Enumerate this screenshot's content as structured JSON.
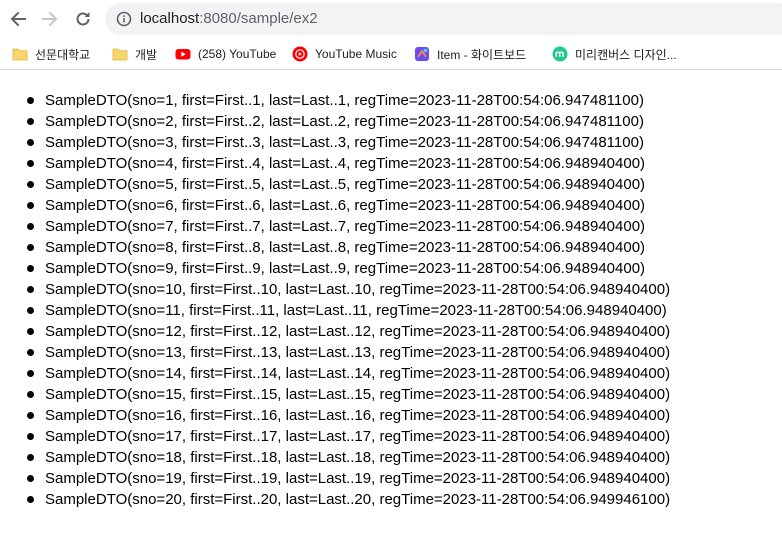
{
  "browser": {
    "url_host": "localhost",
    "url_path": ":8080/sample/ex2"
  },
  "bookmarks": [
    {
      "label": "선문대학교",
      "icon": "folder-icon"
    },
    {
      "label": "개발",
      "icon": "folder-icon"
    },
    {
      "label": "(258) YouTube",
      "icon": "youtube-icon"
    },
    {
      "label": "YouTube Music",
      "icon": "youtube-music-icon"
    },
    {
      "label": "Item - 화이트보드",
      "icon": "whiteboard-icon"
    },
    {
      "label": "미리캔버스 디자인...",
      "icon": "miricanvas-icon"
    }
  ],
  "colors": {
    "youtube_red": "#ff0000",
    "folder_yellow": "#f9d66b",
    "miricanvas_green": "#1fc98e",
    "whiteboard_purple": "#6a4df2"
  },
  "items": [
    "SampleDTO(sno=1, first=First..1, last=Last..1, regTime=2023-11-28T00:54:06.947481100)",
    "SampleDTO(sno=2, first=First..2, last=Last..2, regTime=2023-11-28T00:54:06.947481100)",
    "SampleDTO(sno=3, first=First..3, last=Last..3, regTime=2023-11-28T00:54:06.947481100)",
    "SampleDTO(sno=4, first=First..4, last=Last..4, regTime=2023-11-28T00:54:06.948940400)",
    "SampleDTO(sno=5, first=First..5, last=Last..5, regTime=2023-11-28T00:54:06.948940400)",
    "SampleDTO(sno=6, first=First..6, last=Last..6, regTime=2023-11-28T00:54:06.948940400)",
    "SampleDTO(sno=7, first=First..7, last=Last..7, regTime=2023-11-28T00:54:06.948940400)",
    "SampleDTO(sno=8, first=First..8, last=Last..8, regTime=2023-11-28T00:54:06.948940400)",
    "SampleDTO(sno=9, first=First..9, last=Last..9, regTime=2023-11-28T00:54:06.948940400)",
    "SampleDTO(sno=10, first=First..10, last=Last..10, regTime=2023-11-28T00:54:06.948940400)",
    "SampleDTO(sno=11, first=First..11, last=Last..11, regTime=2023-11-28T00:54:06.948940400)",
    "SampleDTO(sno=12, first=First..12, last=Last..12, regTime=2023-11-28T00:54:06.948940400)",
    "SampleDTO(sno=13, first=First..13, last=Last..13, regTime=2023-11-28T00:54:06.948940400)",
    "SampleDTO(sno=14, first=First..14, last=Last..14, regTime=2023-11-28T00:54:06.948940400)",
    "SampleDTO(sno=15, first=First..15, last=Last..15, regTime=2023-11-28T00:54:06.948940400)",
    "SampleDTO(sno=16, first=First..16, last=Last..16, regTime=2023-11-28T00:54:06.948940400)",
    "SampleDTO(sno=17, first=First..17, last=Last..17, regTime=2023-11-28T00:54:06.948940400)",
    "SampleDTO(sno=18, first=First..18, last=Last..18, regTime=2023-11-28T00:54:06.948940400)",
    "SampleDTO(sno=19, first=First..19, last=Last..19, regTime=2023-11-28T00:54:06.948940400)",
    "SampleDTO(sno=20, first=First..20, last=Last..20, regTime=2023-11-28T00:54:06.949946100)"
  ]
}
